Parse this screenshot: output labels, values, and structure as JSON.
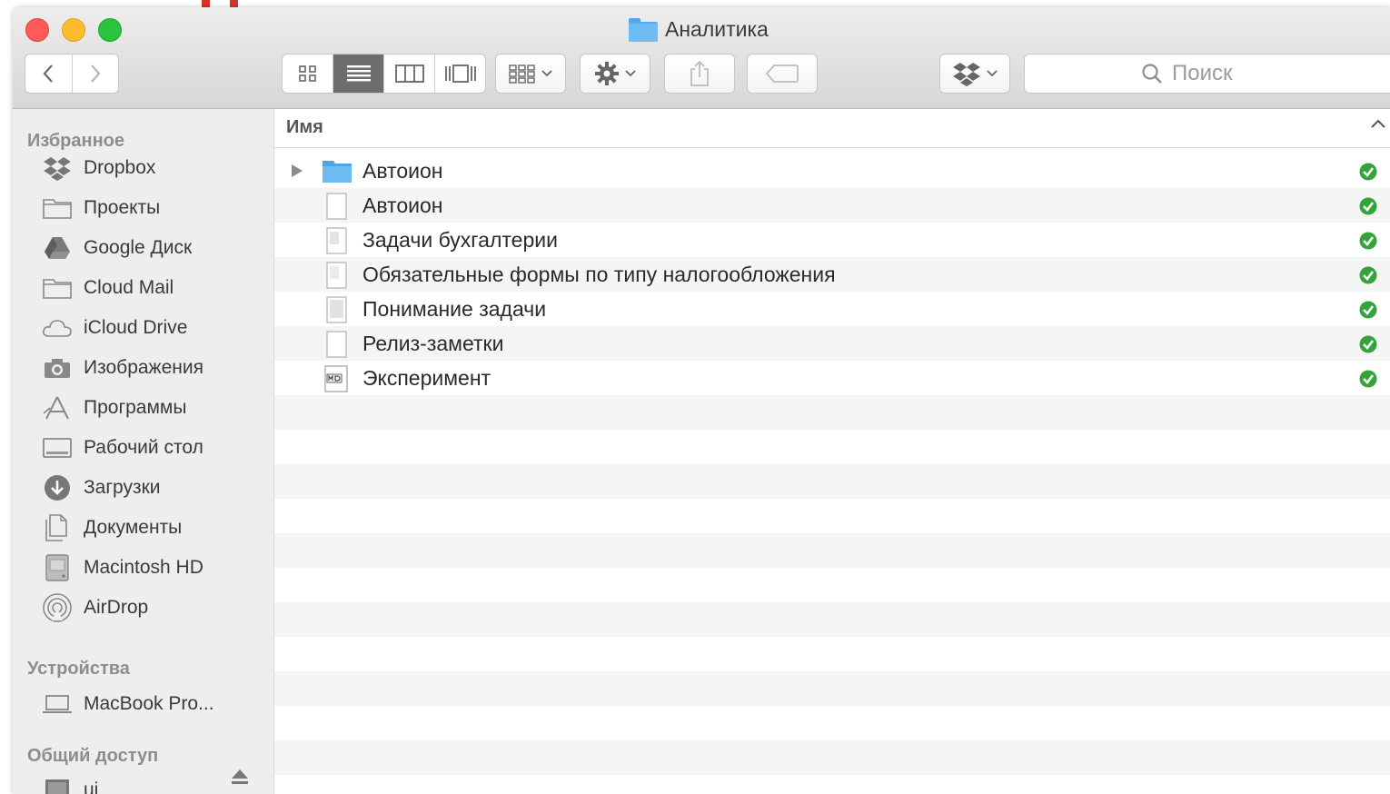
{
  "window": {
    "title": "Аналитика"
  },
  "colors": {
    "accent_folder": "#6cbcf3",
    "sync_ok": "#33a33a",
    "red_mark": "#d8332a"
  },
  "toolbar": {
    "buttons": [
      "back-icon",
      "forward-icon",
      "icon-view",
      "list-view",
      "column-view",
      "cover-flow-view",
      "arrange-menu",
      "action-menu",
      "share",
      "tag",
      "dropbox-menu"
    ],
    "search_placeholder": "Поиск"
  },
  "sidebar": {
    "favorites_title": "Избранное",
    "favorites": [
      {
        "label": "Dropbox",
        "icon": "dropbox-icon"
      },
      {
        "label": "Проекты",
        "icon": "folder-icon"
      },
      {
        "label": "Google Диск",
        "icon": "google-drive-icon"
      },
      {
        "label": "Cloud Mail",
        "icon": "folder-icon"
      },
      {
        "label": "iCloud Drive",
        "icon": "cloud-icon"
      },
      {
        "label": "Изображения",
        "icon": "camera-icon"
      },
      {
        "label": "Программы",
        "icon": "apps-icon"
      },
      {
        "label": "Рабочий стол",
        "icon": "desktop-icon"
      },
      {
        "label": "Загрузки",
        "icon": "downloads-icon"
      },
      {
        "label": "Документы",
        "icon": "documents-icon"
      },
      {
        "label": "Macintosh HD",
        "icon": "disk-icon"
      },
      {
        "label": "AirDrop",
        "icon": "airdrop-icon"
      }
    ],
    "devices_title": "Устройства",
    "devices": [
      {
        "label": "MacBook Pro...",
        "icon": "laptop-icon"
      }
    ],
    "shared_title": "Общий доступ",
    "shared": [
      {
        "label": "ui",
        "icon": "display-icon"
      }
    ]
  },
  "file_list": {
    "column_header": "Имя",
    "rows": [
      {
        "name": "Автоион",
        "type": "folder",
        "status": "synced"
      },
      {
        "name": "Автоион",
        "type": "doc",
        "status": "synced"
      },
      {
        "name": "Задачи бухгалтерии",
        "type": "doc",
        "status": "synced"
      },
      {
        "name": "Обязательные формы по типу налогообложения",
        "type": "doc",
        "status": "synced"
      },
      {
        "name": "Понимание задачи",
        "type": "doc",
        "status": "synced"
      },
      {
        "name": "Релиз-заметки",
        "type": "doc",
        "status": "synced"
      },
      {
        "name": "Эксперимент",
        "type": "md",
        "status": "synced"
      }
    ]
  }
}
